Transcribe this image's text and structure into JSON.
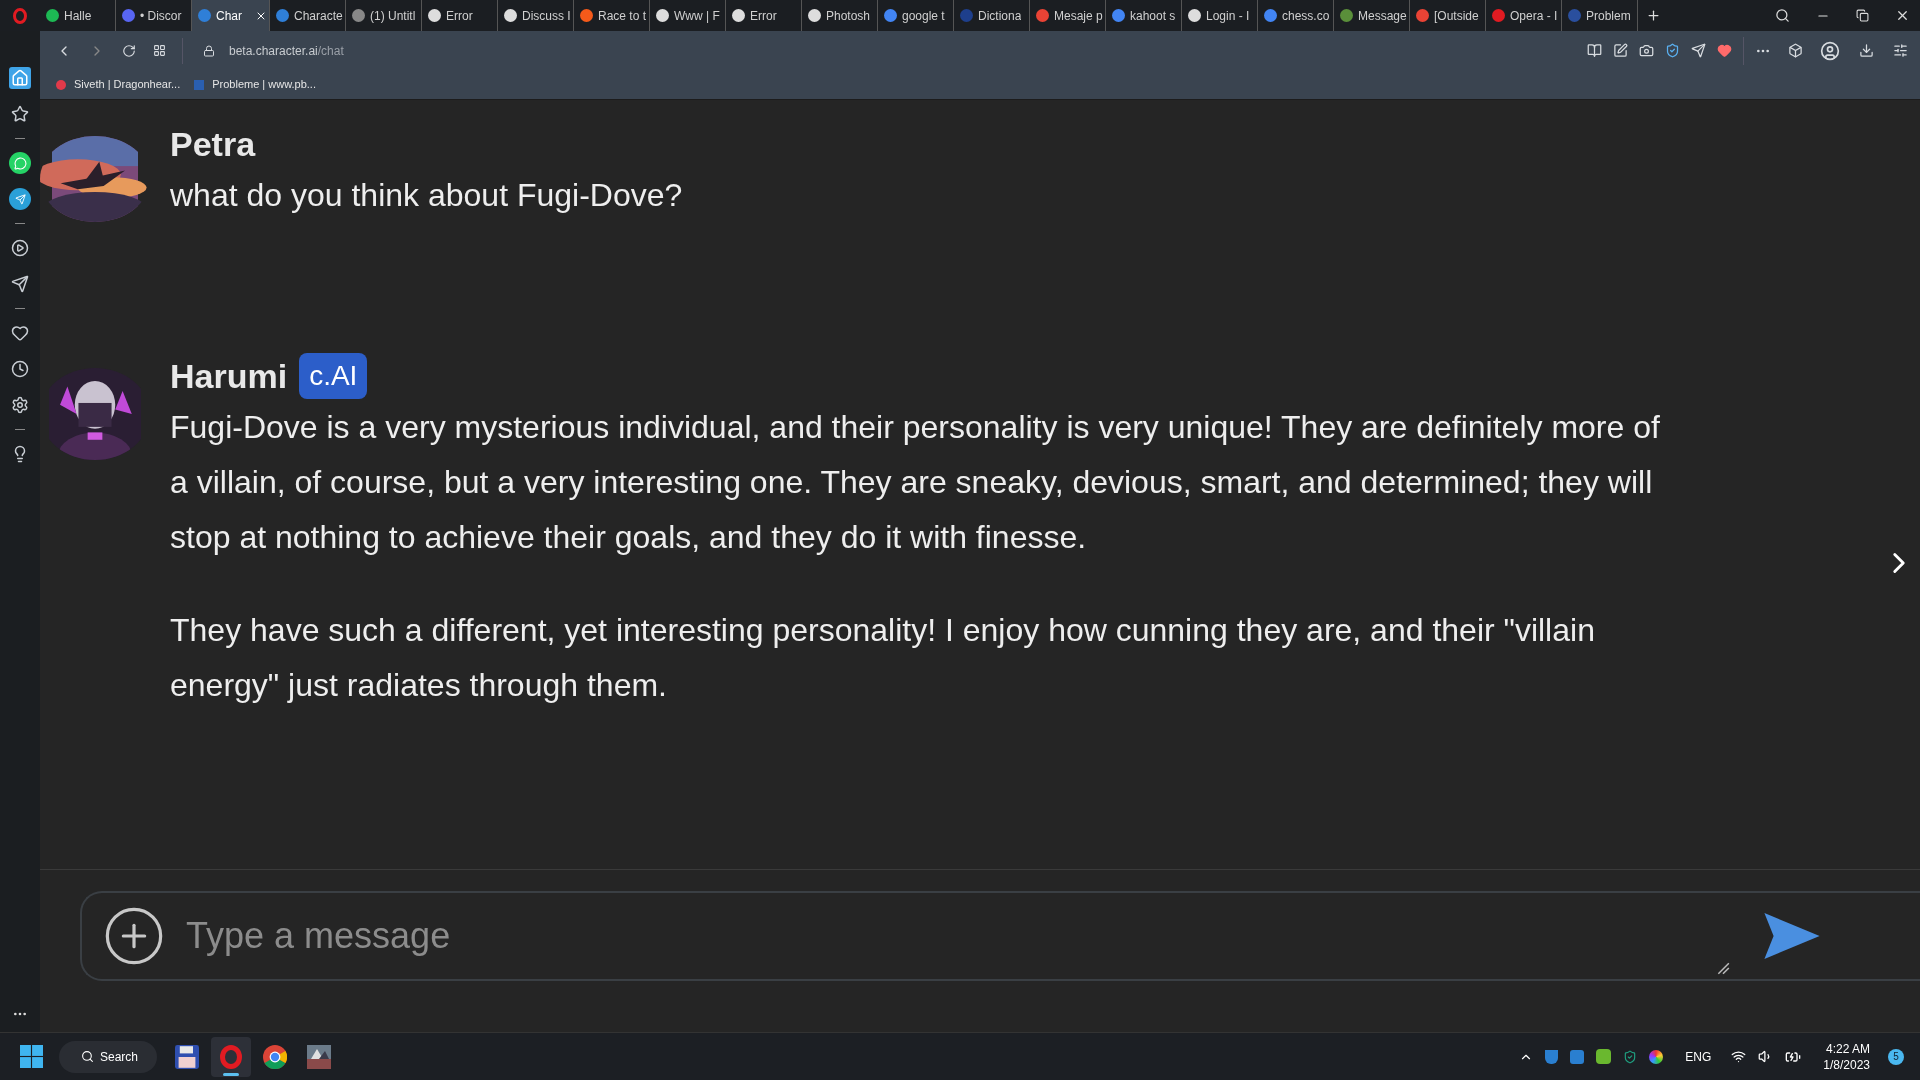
{
  "tabs": [
    {
      "title": "Halle",
      "selected": false
    },
    {
      "title": "• Discor",
      "selected": false
    },
    {
      "title": "Char",
      "selected": true
    },
    {
      "title": "Characte",
      "selected": false
    },
    {
      "title": "(1) Untitl",
      "selected": false
    },
    {
      "title": "Error",
      "selected": false
    },
    {
      "title": "Discuss I",
      "selected": false
    },
    {
      "title": "Race to t",
      "selected": false
    },
    {
      "title": "Www | F",
      "selected": false
    },
    {
      "title": "Error",
      "selected": false
    },
    {
      "title": "Photosh",
      "selected": false
    },
    {
      "title": "google t",
      "selected": false
    },
    {
      "title": "Dictiona",
      "selected": false
    },
    {
      "title": "Mesaje p",
      "selected": false
    },
    {
      "title": "kahoot s",
      "selected": false
    },
    {
      "title": "Login - I",
      "selected": false
    },
    {
      "title": "chess.co",
      "selected": false
    },
    {
      "title": "Message",
      "selected": false
    },
    {
      "title": "[Outside",
      "selected": false
    },
    {
      "title": "Opera - I",
      "selected": false
    },
    {
      "title": "Problem",
      "selected": false
    }
  ],
  "address_bar": {
    "url_host": "beta.character.ai",
    "url_path": "/chat"
  },
  "bookmarks": [
    "Siveth | Dragonhear...",
    "Probleme | www.pb..."
  ],
  "sidebar": {
    "items": [
      {
        "kind": "home",
        "selected": true
      },
      {
        "kind": "star",
        "selected": false
      },
      {
        "kind": "whatsapp",
        "selected": false
      },
      {
        "kind": "telegram",
        "selected": false
      },
      {
        "kind": "player",
        "selected": false
      },
      {
        "kind": "send",
        "selected": false
      },
      {
        "kind": "heart",
        "selected": false
      },
      {
        "kind": "history",
        "selected": false
      },
      {
        "kind": "settings",
        "selected": false
      },
      {
        "kind": "bulb",
        "selected": false
      }
    ]
  },
  "messages": [
    {
      "author": "Petra",
      "paragraphs": [
        "what do you think about Fugi-Dove?"
      ]
    },
    {
      "author": "Harumi",
      "badge": "c.AI",
      "paragraphs": [
        "Fugi-Dove is a very mysterious individual, and their personality is very unique! They are definitely more of a villain, of course, but a very interesting one. They are sneaky, devious, smart, and determined; they will stop at nothing to achieve their goals, and they do it with finesse.",
        "They have such a different, yet interesting personality! I enjoy how cunning they are, and their \"villain energy\" just radiates through them."
      ]
    }
  ],
  "composer": {
    "placeholder": "Type a message"
  },
  "taskbar": {
    "search": "Search",
    "apps": [
      {
        "kind": "disk",
        "selected": false
      },
      {
        "kind": "opera",
        "selected": true
      },
      {
        "kind": "chrome",
        "selected": false
      },
      {
        "kind": "game",
        "selected": false
      }
    ],
    "language": "ENG",
    "time": "4:22 AM",
    "date": "1/8/2023",
    "notifications": "5"
  }
}
